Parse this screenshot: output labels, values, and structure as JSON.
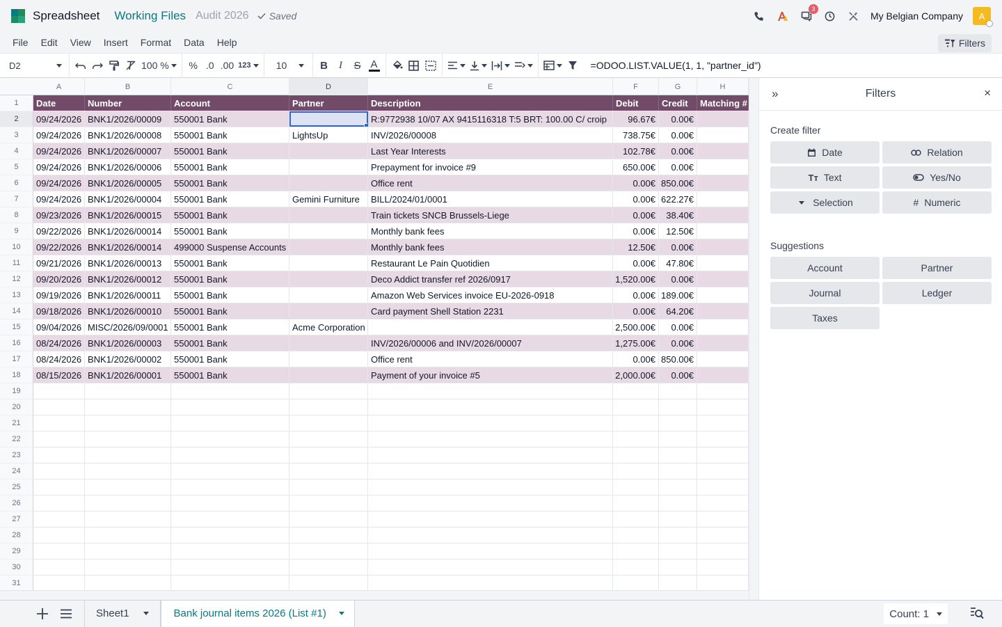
{
  "header": {
    "app_name": "Spreadsheet",
    "breadcrumb_parent": "Working Files",
    "breadcrumb_current": "Audit 2026",
    "saved_label": "Saved",
    "messages_badge": "3",
    "company": "My Belgian Company",
    "avatar_letter": "A"
  },
  "menu": [
    "File",
    "Edit",
    "View",
    "Insert",
    "Format",
    "Data",
    "Help"
  ],
  "filters_button": "Filters",
  "toolbar": {
    "cell_ref": "D2",
    "zoom": "100 %",
    "percent": "%",
    "dec_decrease": ".0",
    "dec_increase": ".00",
    "format_123": "123",
    "font_size": "10",
    "bold": "B",
    "italic": "I",
    "strike": "S",
    "text_color": "A",
    "formula": "=ODOO.LIST.VALUE(1, 1, \"partner_id\")"
  },
  "grid": {
    "columns": [
      "A",
      "B",
      "C",
      "D",
      "E",
      "F",
      "G",
      "H"
    ],
    "selected_column": "D",
    "selected_row": 2,
    "row_numbers": [
      "1",
      "2",
      "3",
      "4",
      "5",
      "6",
      "7",
      "8",
      "9",
      "10",
      "11",
      "12",
      "13",
      "14",
      "15",
      "16",
      "17",
      "18",
      "19",
      "20",
      "21",
      "22",
      "23",
      "24",
      "25",
      "26",
      "27",
      "28",
      "29",
      "30",
      "31"
    ],
    "header_row": [
      "Date",
      "Number",
      "Account",
      "Partner",
      "Description",
      "Debit",
      "Credit",
      "Matching #"
    ],
    "rows": [
      [
        "09/24/2026",
        "BNK1/2026/00009",
        "550001 Bank",
        "",
        "R:9772938  10/07 AX 9415116318 T:5 BRT: 100.00 C/ croip",
        "96.67€",
        "0.00€",
        ""
      ],
      [
        "09/24/2026",
        "BNK1/2026/00008",
        "550001 Bank",
        "LightsUp",
        "INV/2026/00008",
        "738.75€",
        "0.00€",
        ""
      ],
      [
        "09/24/2026",
        "BNK1/2026/00007",
        "550001 Bank",
        "",
        "Last Year Interests",
        "102.78€",
        "0.00€",
        ""
      ],
      [
        "09/24/2026",
        "BNK1/2026/00006",
        "550001 Bank",
        "",
        "Prepayment for invoice #9",
        "650.00€",
        "0.00€",
        ""
      ],
      [
        "09/24/2026",
        "BNK1/2026/00005",
        "550001 Bank",
        "",
        "Office rent",
        "0.00€",
        "850.00€",
        ""
      ],
      [
        "09/24/2026",
        "BNK1/2026/00004",
        "550001 Bank",
        "Gemini Furniture",
        "BILL/2024/01/0001",
        "0.00€",
        "622.27€",
        ""
      ],
      [
        "09/23/2026",
        "BNK1/2026/00015",
        "550001 Bank",
        "",
        "Train tickets SNCB Brussels-Liege",
        "0.00€",
        "38.40€",
        ""
      ],
      [
        "09/22/2026",
        "BNK1/2026/00014",
        "550001 Bank",
        "",
        "Monthly bank fees",
        "0.00€",
        "12.50€",
        ""
      ],
      [
        "09/22/2026",
        "BNK1/2026/00014",
        "499000 Suspense Accounts",
        "",
        "Monthly bank fees",
        "12.50€",
        "0.00€",
        ""
      ],
      [
        "09/21/2026",
        "BNK1/2026/00013",
        "550001 Bank",
        "",
        "Restaurant Le Pain Quotidien",
        "0.00€",
        "47.80€",
        ""
      ],
      [
        "09/20/2026",
        "BNK1/2026/00012",
        "550001 Bank",
        "",
        "Deco Addict transfer ref 2026/0917",
        "1,520.00€",
        "0.00€",
        ""
      ],
      [
        "09/19/2026",
        "BNK1/2026/00011",
        "550001 Bank",
        "",
        "Amazon Web Services invoice EU-2026-0918",
        "0.00€",
        "189.00€",
        ""
      ],
      [
        "09/18/2026",
        "BNK1/2026/00010",
        "550001 Bank",
        "",
        "Card payment Shell Station 2231",
        "0.00€",
        "64.20€",
        ""
      ],
      [
        "09/04/2026",
        "MISC/2026/09/0001",
        "550001 Bank",
        "Acme Corporation",
        "",
        "2,500.00€",
        "0.00€",
        ""
      ],
      [
        "08/24/2026",
        "BNK1/2026/00003",
        "550001 Bank",
        "",
        "INV/2026/00006 and INV/2026/00007",
        "1,275.00€",
        "0.00€",
        ""
      ],
      [
        "08/24/2026",
        "BNK1/2026/00002",
        "550001 Bank",
        "",
        "Office rent",
        "0.00€",
        "850.00€",
        ""
      ],
      [
        "08/15/2026",
        "BNK1/2026/00001",
        "550001 Bank",
        "",
        "Payment of your invoice #5",
        "2,000.00€",
        "0.00€",
        ""
      ]
    ],
    "colors": {
      "header_bg": "#714b67",
      "band_bg": "#e8dae4",
      "selection": "#3266ca"
    }
  },
  "panel": {
    "title": "Filters",
    "create_filter_title": "Create filter",
    "create_buttons": [
      {
        "label": "Date",
        "icon": "calendar-icon"
      },
      {
        "label": "Relation",
        "icon": "link-icon"
      },
      {
        "label": "Text",
        "icon": "text-icon"
      },
      {
        "label": "Yes/No",
        "icon": "toggle-icon"
      },
      {
        "label": "Selection",
        "icon": "caret-down-icon"
      },
      {
        "label": "Numeric",
        "icon": "hash-icon"
      }
    ],
    "suggestions_title": "Suggestions",
    "suggestions": [
      "Account",
      "Partner",
      "Journal",
      "Ledger",
      "Taxes"
    ]
  },
  "bottom": {
    "sheets": [
      {
        "name": "Sheet1",
        "active": false
      },
      {
        "name": "Bank journal items 2026 (List #1)",
        "active": true
      }
    ],
    "count_label": "Count: 1"
  }
}
